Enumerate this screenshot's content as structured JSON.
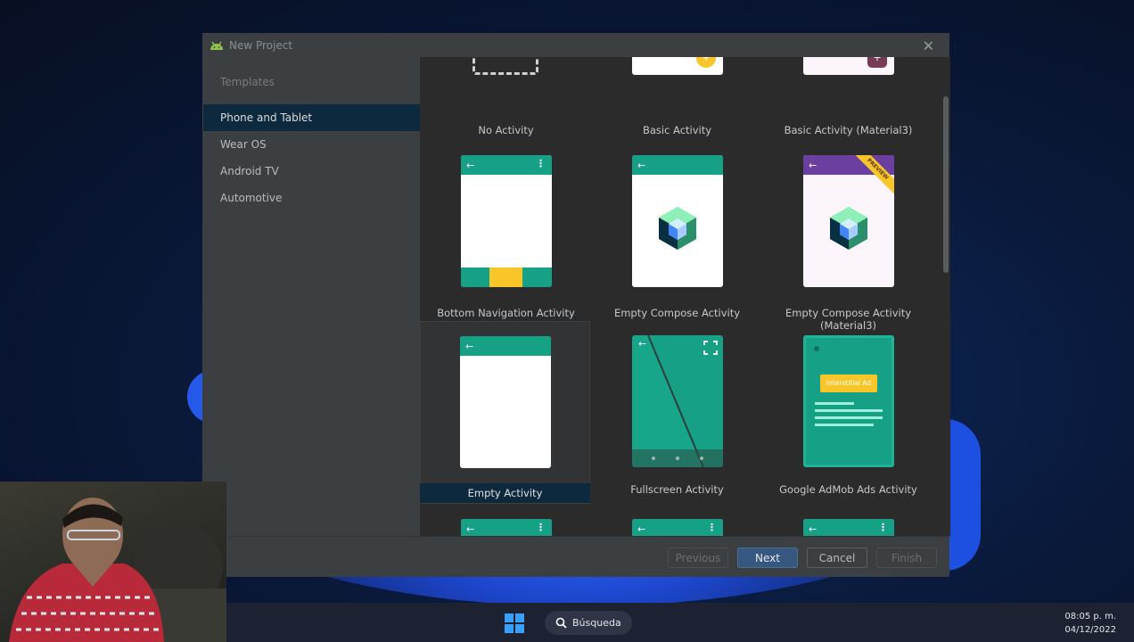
{
  "dialog": {
    "title": "New Project",
    "sidebar": {
      "heading": "Templates",
      "items": [
        "Phone and Tablet",
        "Wear OS",
        "Android TV",
        "Automotive"
      ],
      "selected_index": 0
    },
    "templates": [
      {
        "label": "No Activity"
      },
      {
        "label": "Basic Activity"
      },
      {
        "label": "Basic Activity (Material3)"
      },
      {
        "label": "Bottom Navigation Activity"
      },
      {
        "label": "Empty Compose Activity"
      },
      {
        "label": "Empty Compose Activity (Material3)",
        "badge": "PREVIEW"
      },
      {
        "label": "Empty Activity"
      },
      {
        "label": "Fullscreen Activity"
      },
      {
        "label": "Google AdMob Ads Activity",
        "ad_label": "Interstitial Ad"
      }
    ],
    "selected_template": "Empty Activity",
    "buttons": {
      "previous": "Previous",
      "next": "Next",
      "cancel": "Cancel",
      "finish": "Finish"
    }
  },
  "taskbar": {
    "search_label": "Búsqueda",
    "time": "08:05 p. m.",
    "date": "04/12/2022"
  },
  "colors": {
    "teal": "#16a086",
    "purple": "#6a3fa0",
    "selection": "#0d293e",
    "primary_button": "#365880"
  }
}
